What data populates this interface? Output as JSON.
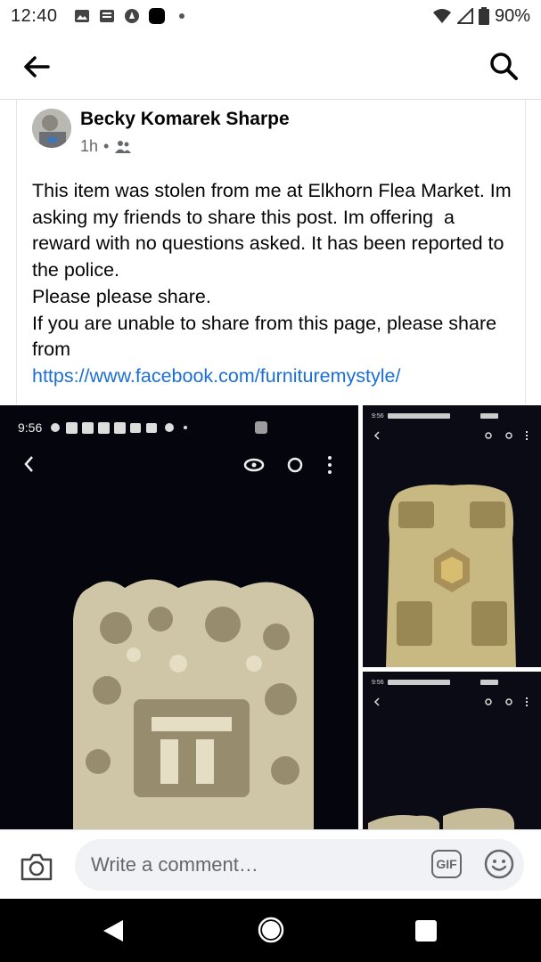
{
  "status_bar": {
    "time": "12:40",
    "battery": "90%",
    "icons": [
      "image-icon",
      "news-icon",
      "alarm-icon",
      "app-icon",
      "dot-icon",
      "wifi-icon",
      "signal-icon",
      "battery-icon"
    ]
  },
  "top_bar": {
    "back_icon": "arrow-left-icon",
    "search_icon": "search-icon"
  },
  "post": {
    "author": "Becky Komarek Sharpe",
    "time": "1h",
    "audience_icon": "friends-icon",
    "text_lines": [
      "This item was stolen from me at Elkhorn Flea Market. Im asking my friends to share this post. Im offering  a reward with no questions asked. It has been reported to the police.",
      "Please please share.",
      "If you are unable to share from this page, please share from"
    ],
    "link": "https://www.facebook.com/furnituremystyle/"
  },
  "photos": {
    "main_screenshot_time": "9:56",
    "thumb_a_time": "9:56",
    "thumb_b_time": "9:56"
  },
  "composer": {
    "placeholder": "Write a comment…",
    "gif_label": "GIF",
    "camera_icon": "camera-icon",
    "emoji_icon": "smiley-icon"
  },
  "nav_bar": {
    "back_icon": "triangle-back-icon",
    "home_icon": "circle-home-icon",
    "recents_icon": "square-recents-icon"
  }
}
